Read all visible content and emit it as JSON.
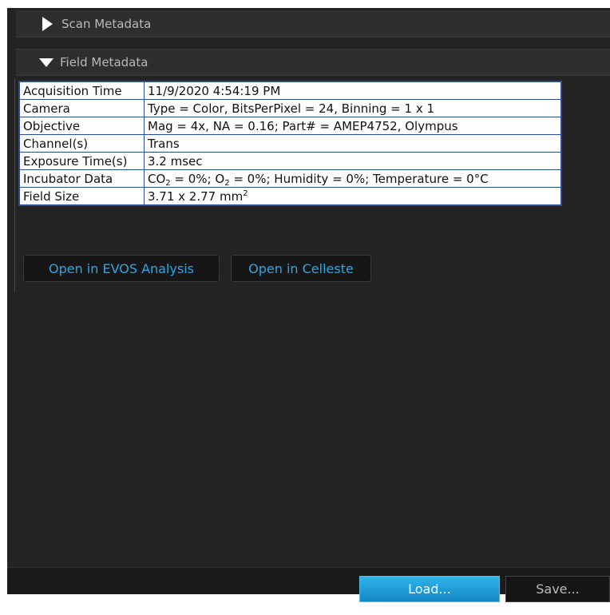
{
  "sections": {
    "scan_metadata": {
      "label": "Scan Metadata",
      "expanded": false
    },
    "field_metadata": {
      "label": "Field Metadata",
      "expanded": true
    }
  },
  "field_table": {
    "acquisition_time": {
      "label": "Acquisition Time",
      "value": "11/9/2020 4:54:19 PM"
    },
    "camera": {
      "label": "Camera",
      "value": "Type = Color, BitsPerPixel = 24, Binning = 1 x 1"
    },
    "objective": {
      "label": "Objective",
      "value": "Mag = 4x, NA = 0.16; Part# = AMEP4752, Olympus"
    },
    "channels": {
      "label": "Channel(s)",
      "value": "Trans"
    },
    "exposure_time": {
      "label": "Exposure Time(s)",
      "value": "3.2 msec"
    },
    "incubator_data": {
      "label": "Incubator Data",
      "co2_prefix": "CO",
      "co2_sub": "2",
      "co2_value": " = 0%; ",
      "o2_prefix": "O",
      "o2_sub": "2",
      "rest": " = 0%; Humidity = 0%; Temperature = 0°C"
    },
    "field_size": {
      "label": "Field Size",
      "value": "3.71 x 2.77 mm",
      "unit_sup": "2"
    }
  },
  "actions": {
    "open_evos": "Open in EVOS Analysis",
    "open_celleste": "Open in Celleste"
  },
  "footer": {
    "load": "Load...",
    "save": "Save..."
  },
  "colors": {
    "accent_text": "#2aa7e8",
    "primary_button": "#1e9bd7",
    "table_border": "#2a4a9a",
    "panel_bg": "#232323"
  }
}
